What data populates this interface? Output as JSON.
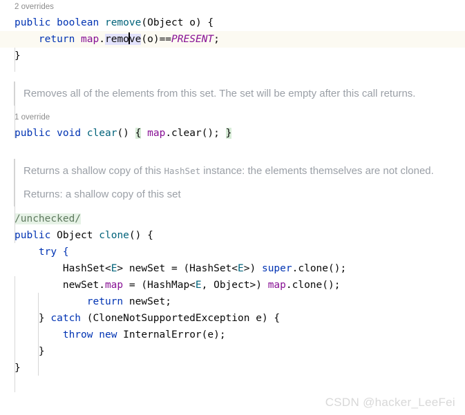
{
  "editor": {
    "language": "java",
    "theme": "IntelliJ Light",
    "colors": {
      "background": "#ffffff",
      "keyword": "#0033b3",
      "method_declaration": "#00627a",
      "field": "#871094",
      "constant_italic": "#871094",
      "generic_type": "#00627a",
      "doc_text": "#9a9fa6",
      "inlay_hint": "#8c8c8c",
      "current_line_bg": "#fcfaf2",
      "brace_match_bg": "#d7ecd7",
      "identifier_highlight_bg": "#e2e2fc",
      "annotation_bg": "#e6f2e6",
      "indent_guide": "#d6d6d6",
      "doc_quote_bar": "#d4d4d4",
      "watermark": "#d8d8d8"
    }
  },
  "blocks": {
    "remove_hint": "2 overrides",
    "remove_signature": {
      "kw_public": "public",
      "kw_boolean": "boolean",
      "name": "remove",
      "open_paren": "(",
      "param_type": "Object",
      "param_name": " o",
      "close_paren": ")",
      "open_brace": " {"
    },
    "remove_body": {
      "kw_return": "return",
      "field": "map",
      "dot": ".",
      "call_before_caret": "remo",
      "call_after_caret": "ve",
      "args": "(o)",
      "operator": "==",
      "constant": "PRESENT",
      "semicolon": ";"
    },
    "remove_close": "}",
    "clear_doc": {
      "paragraph_1": "Removes all of the elements from this set. The set will be empty after this call returns."
    },
    "clear_hint": "1 override",
    "clear_signature": {
      "kw_public": "public",
      "kw_void": "void",
      "name": "clear",
      "parens": "()",
      "open_brace": "{",
      "field": "map",
      "dot_call": ".clear();",
      "close_brace": "}"
    },
    "clone_doc": {
      "paragraph_1_pre": "Returns a shallow copy of this ",
      "paragraph_1_code": "HashSet",
      "paragraph_1_post": " instance: the elements themselves are not cloned.",
      "paragraph_2": "Returns: a shallow copy of this set"
    },
    "clone_annotation": "/unchecked/",
    "clone_signature": {
      "kw_public": "public",
      "type": "Object",
      "name": "clone",
      "parens": "()",
      "open_brace": " {"
    },
    "clone_body": {
      "line_try": "try {",
      "line_newset_pre": "HashSet<",
      "line_newset_gen": "E",
      "line_newset_mid": "> newSet = (HashSet<",
      "line_newset_gen2": "E",
      "line_newset_mid2": ">) ",
      "line_newset_super": "super",
      "line_newset_end": ".clone();",
      "line_map_pre": "newSet.",
      "line_map_field": "map",
      "line_map_mid": " = (HashMap<",
      "line_map_gen": "E",
      "line_map_mid2": ", Object>) ",
      "line_map_field2": "map",
      "line_map_end": ".clone();",
      "line_return_kw": "return",
      "line_return_rest": " newSet;",
      "line_catch_brace": "} ",
      "line_catch_kw": "catch",
      "line_catch_rest": " (CloneNotSupportedException e) {",
      "line_throw_kw": "throw",
      "line_new_kw": "new",
      "line_throw_rest": " InternalError(e);",
      "line_inner_close": "}",
      "line_outer_close": "}"
    }
  },
  "watermark": {
    "text": "CSDN @hacker_LeeFei"
  }
}
